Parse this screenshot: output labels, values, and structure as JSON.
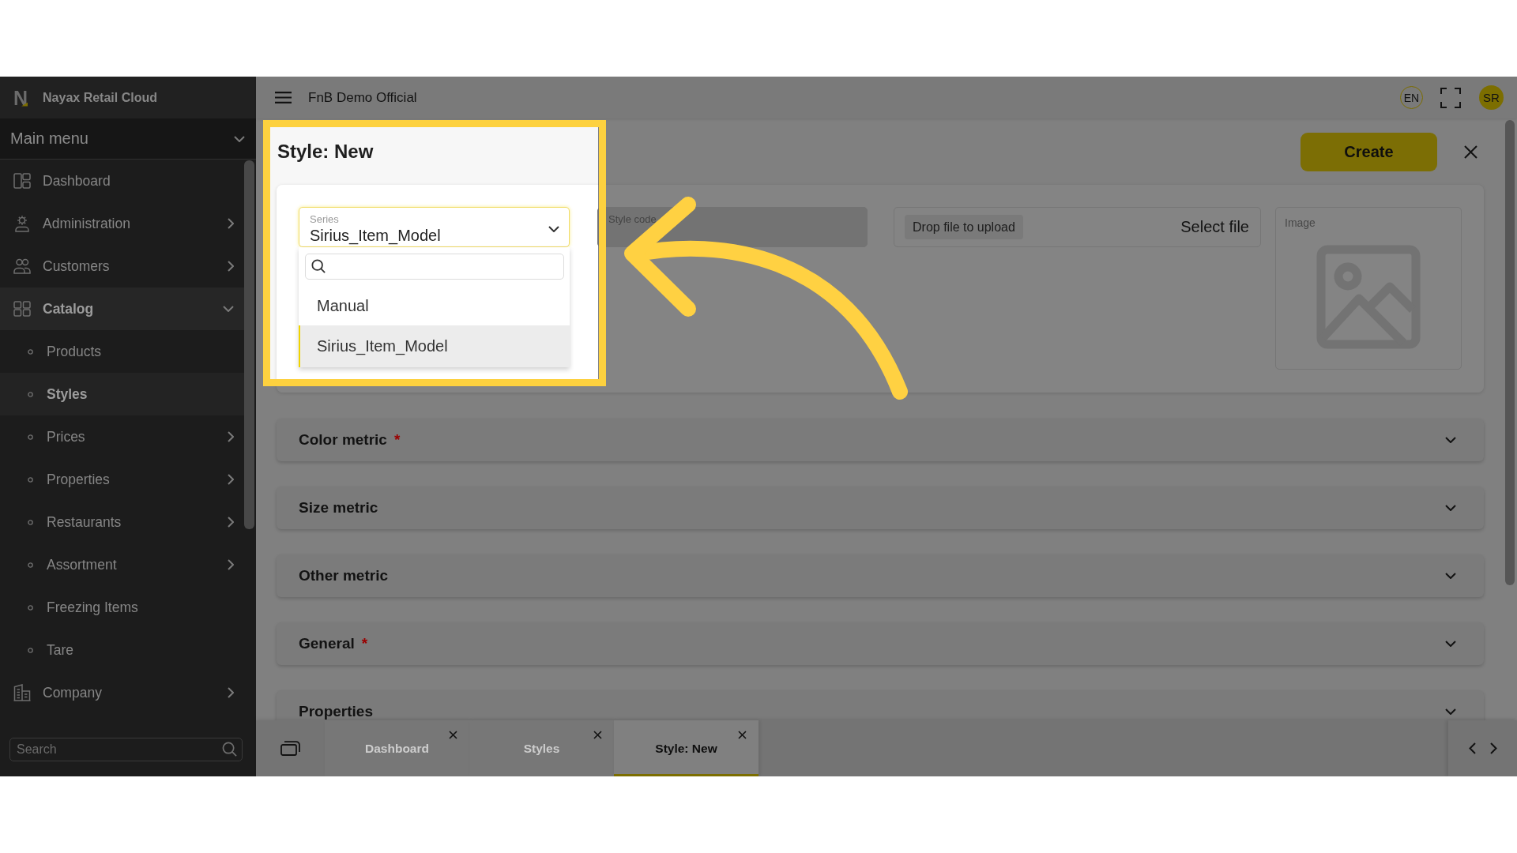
{
  "sidebar": {
    "logo": "N",
    "brand": "Nayax Retail Cloud",
    "menu_title": "Main menu",
    "menu_expanded": true,
    "items": [
      {
        "label": "Dashboard",
        "kind": "link",
        "selected": false
      },
      {
        "label": "Administration",
        "kind": "group",
        "expanded": false,
        "selected": false
      },
      {
        "label": "Customers",
        "kind": "group",
        "expanded": false,
        "selected": false
      },
      {
        "label": "Catalog",
        "kind": "group",
        "expanded": true,
        "selected": false,
        "children": [
          {
            "label": "Products",
            "kind": "link",
            "selected": false
          },
          {
            "label": "Styles",
            "kind": "link",
            "selected": true
          },
          {
            "label": "Prices",
            "kind": "group",
            "expanded": false,
            "selected": false
          },
          {
            "label": "Properties",
            "kind": "group",
            "expanded": false,
            "selected": false
          },
          {
            "label": "Restaurants",
            "kind": "group",
            "expanded": false,
            "selected": false
          },
          {
            "label": "Assortment",
            "kind": "group",
            "expanded": false,
            "selected": false
          },
          {
            "label": "Freezing Items",
            "kind": "link",
            "selected": false
          },
          {
            "label": "Tare",
            "kind": "link",
            "selected": false
          }
        ]
      },
      {
        "label": "Company",
        "kind": "group",
        "expanded": false,
        "selected": false
      }
    ],
    "search": {
      "placeholder": "Search"
    }
  },
  "topbar": {
    "title": "FnB Demo Official",
    "language": "EN",
    "user_initials": "SR"
  },
  "form": {
    "title": "Style: New",
    "create_label": "Create",
    "series": {
      "label": "Series",
      "value": "Sirius_Item_Model",
      "open": true,
      "options": [
        {
          "label": "Manual",
          "selected": false
        },
        {
          "label": "Sirius_Item_Model",
          "selected": true
        }
      ]
    },
    "style_code": {
      "label": "Style code",
      "disabled": true
    },
    "upload": {
      "hint": "Drop file to upload",
      "button": "Select file"
    },
    "image": {
      "label": "Image"
    },
    "sections": [
      {
        "title": "Color metric",
        "required_mark": "*",
        "expanded": false
      },
      {
        "title": "Size metric",
        "expanded": false
      },
      {
        "title": "Other metric",
        "expanded": false
      },
      {
        "title": "General",
        "required_mark": "*",
        "expanded": false
      },
      {
        "title": "Properties",
        "expanded": false
      }
    ]
  },
  "tabs": [
    {
      "label": "Dashboard",
      "selected": false
    },
    {
      "label": "Styles",
      "selected": false
    },
    {
      "label": "Style: New",
      "selected": true
    }
  ]
}
